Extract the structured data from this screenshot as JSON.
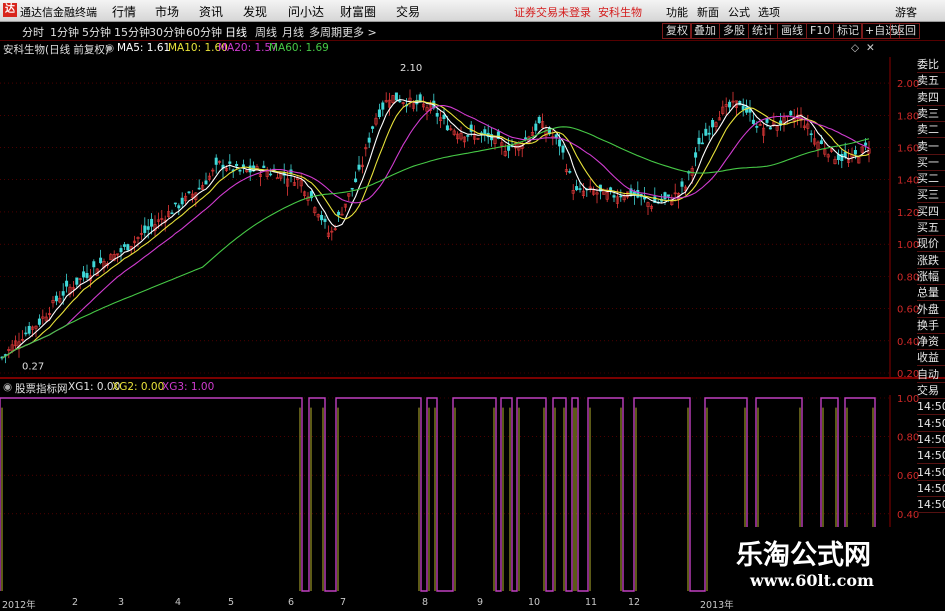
{
  "app": {
    "title": "通达信金融终端",
    "logo": "达"
  },
  "menu": [
    "行情",
    "市场",
    "资讯",
    "发现",
    "问小达",
    "财富圈",
    "交易"
  ],
  "status": "证券交易未登录",
  "stock_name_header": "安科生物",
  "topright": [
    "功能",
    "新面",
    "公式",
    "选项",
    "游客"
  ],
  "periods": [
    "分时",
    "1分钟",
    "5分钟",
    "15分钟",
    "30分钟",
    "60分钟",
    "日线",
    "周线",
    "月线",
    "多周期",
    "更多 >"
  ],
  "active_period": "日线",
  "right_tools": [
    "复权",
    "叠加",
    "多股",
    "统计",
    "画线",
    "F10",
    "标记",
    "+自选",
    "返回"
  ],
  "info": {
    "title": "安科生物(日线 前复权)",
    "ma5": "MA5: 1.61",
    "ma10": "MA10: 1.60",
    "ma20": "MA20: 1.57",
    "ma60": "MA60: 1.69"
  },
  "colors": {
    "ma5": "#ffffff",
    "ma10": "#e8e23a",
    "ma20": "#d03cd0",
    "ma60": "#46c846",
    "up": "#e83a3a",
    "down": "#40d8d8",
    "grid": "#7a0000"
  },
  "price_axis": [
    "2.00",
    "1.80",
    "1.60",
    "1.40",
    "1.20",
    "1.00",
    "0.80",
    "0.60",
    "0.40",
    "0.20"
  ],
  "annotations": {
    "high": "2.10",
    "low": "0.27"
  },
  "indicator": {
    "title": "股票指标网",
    "xg1": "XG1: 0.00",
    "xg2": "XG2: 0.00",
    "xg3": "XG3: 1.00",
    "axis": [
      "1.00",
      "0.80",
      "0.60",
      "0.40"
    ]
  },
  "time_axis": [
    "2012年",
    "2",
    "3",
    "4",
    "5",
    "6",
    "7",
    "8",
    "9",
    "10",
    "11",
    "12",
    "2013年"
  ],
  "right_panel": [
    "委比",
    "卖五",
    "卖四",
    "卖三",
    "卖二",
    "卖一",
    "买一",
    "买二",
    "买三",
    "买四",
    "买五",
    "现价",
    "涨跌",
    "涨幅",
    "总量",
    "外盘",
    "换手",
    "净资",
    "收益",
    "自动",
    "交易",
    "14:50",
    "14:50",
    "14:50",
    "14:50",
    "14:50",
    "14:50",
    "14:50"
  ],
  "watermark": {
    "line1": "乐淘公式网",
    "line2": "www.60lt.com"
  },
  "chart_data": [
    {
      "type": "candlestick",
      "title": "安科生物(日线 前复权)",
      "ylim": [
        0.2,
        2.1
      ],
      "price_axis_ticks": [
        2.0,
        1.8,
        1.6,
        1.4,
        1.2,
        1.0,
        0.8,
        0.6,
        0.4,
        0.2
      ],
      "close_anchors": [
        [
          0,
          0.28
        ],
        [
          20,
          0.42
        ],
        [
          40,
          0.52
        ],
        [
          60,
          0.68
        ],
        [
          80,
          0.78
        ],
        [
          100,
          0.88
        ],
        [
          120,
          0.95
        ],
        [
          140,
          1.05
        ],
        [
          160,
          1.15
        ],
        [
          180,
          1.25
        ],
        [
          200,
          1.35
        ],
        [
          220,
          1.5
        ],
        [
          240,
          1.45
        ],
        [
          260,
          1.46
        ],
        [
          280,
          1.44
        ],
        [
          300,
          1.4
        ],
        [
          315,
          1.25
        ],
        [
          330,
          1.05
        ],
        [
          345,
          1.25
        ],
        [
          360,
          1.45
        ],
        [
          375,
          1.78
        ],
        [
          390,
          1.92
        ],
        [
          410,
          1.88
        ],
        [
          430,
          1.85
        ],
        [
          450,
          1.72
        ],
        [
          470,
          1.68
        ],
        [
          490,
          1.66
        ],
        [
          505,
          1.6
        ],
        [
          520,
          1.62
        ],
        [
          540,
          1.75
        ],
        [
          560,
          1.62
        ],
        [
          575,
          1.32
        ],
        [
          590,
          1.33
        ],
        [
          610,
          1.3
        ],
        [
          630,
          1.32
        ],
        [
          650,
          1.25
        ],
        [
          670,
          1.28
        ],
        [
          685,
          1.35
        ],
        [
          700,
          1.62
        ],
        [
          720,
          1.82
        ],
        [
          740,
          1.88
        ],
        [
          760,
          1.72
        ],
        [
          780,
          1.75
        ],
        [
          800,
          1.8
        ],
        [
          815,
          1.65
        ],
        [
          835,
          1.55
        ],
        [
          850,
          1.52
        ],
        [
          870,
          1.62
        ]
      ],
      "series": [
        {
          "name": "MA5",
          "value": 1.61
        },
        {
          "name": "MA10",
          "value": 1.6
        },
        {
          "name": "MA20",
          "value": 1.57
        },
        {
          "name": "MA60",
          "value": 1.69
        }
      ],
      "annotations": {
        "high": 2.1,
        "low": 0.27
      }
    },
    {
      "type": "step-line",
      "title": "股票指标网",
      "ylim": [
        0,
        1
      ],
      "series": [
        {
          "name": "XG1",
          "current": 0.0
        },
        {
          "name": "XG2",
          "current": 0.0
        },
        {
          "name": "XG3",
          "current": 1.0
        }
      ],
      "high_intervals": [
        [
          0,
          302
        ],
        [
          309,
          325
        ],
        [
          336,
          421
        ],
        [
          427,
          437
        ],
        [
          453,
          496
        ],
        [
          501,
          512
        ],
        [
          517,
          546
        ],
        [
          553,
          566
        ],
        [
          572,
          578
        ],
        [
          588,
          623
        ],
        [
          634,
          690
        ],
        [
          705,
          747
        ],
        [
          756,
          802
        ],
        [
          821,
          838
        ],
        [
          845,
          875
        ]
      ]
    }
  ]
}
